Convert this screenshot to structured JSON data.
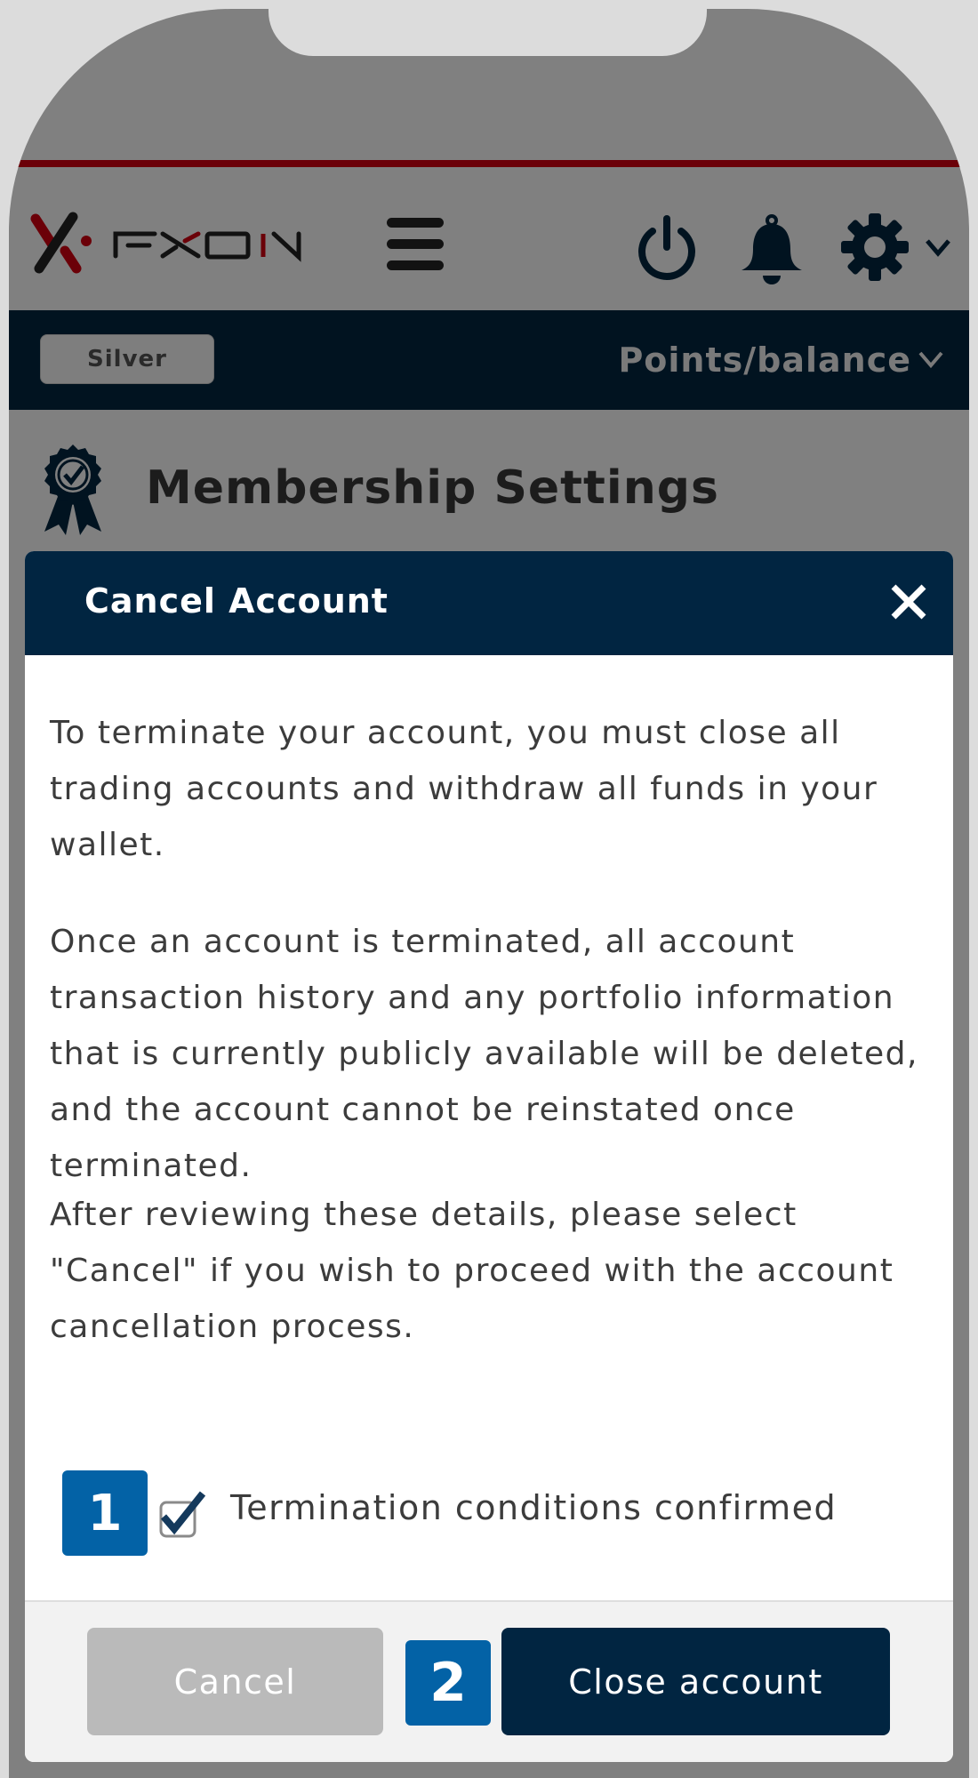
{
  "header": {
    "logo_text": "FXON",
    "icons": [
      "hamburger-menu-icon",
      "power-icon",
      "bell-icon",
      "gear-icon",
      "chevron-down-icon"
    ]
  },
  "account_bar": {
    "tier_label": "Silver",
    "points_label": "Points/balance"
  },
  "page": {
    "title": "Membership Settings",
    "icon": "award-ribbon-icon"
  },
  "modal": {
    "title": "Cancel Account",
    "paragraphs": [
      "To terminate your account, you must close all trading accounts and withdraw all funds in your wallet.",
      "Once an account is terminated, all account transaction history and any portfolio information that is currently publicly available will be deleted, and the account cannot be reinstated once terminated.",
      "After reviewing these details, please select \"Cancel\" if you wish to proceed with the account cancellation process."
    ],
    "checkbox": {
      "label": "Termination conditions confirmed",
      "checked": true
    },
    "buttons": {
      "cancel_label": "Cancel",
      "close_label": "Close account"
    }
  },
  "annotations": {
    "step1": "1",
    "step2": "2"
  },
  "colors": {
    "navy": "#012541",
    "dark_bar": "#011320",
    "accent_red": "#6b0008",
    "badge_blue": "#0362a6",
    "cancel_gray": "#bababa"
  }
}
